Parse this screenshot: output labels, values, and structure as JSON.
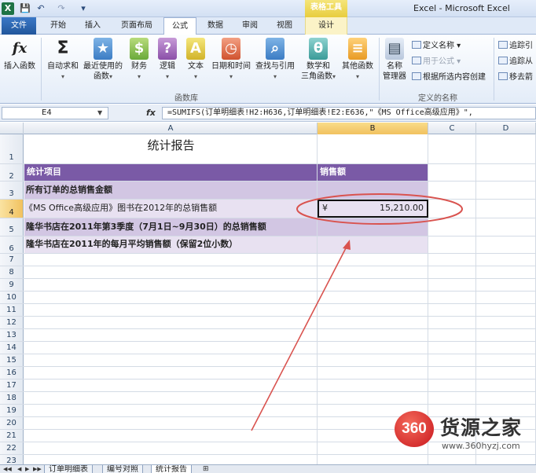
{
  "quick_access": {
    "excel": "X",
    "save": "💾",
    "undo": "↶",
    "redo": "↷",
    "customize": "▾"
  },
  "app_title": "Excel - Microsoft Excel",
  "context_tab_group": "表格工具",
  "tabs": [
    "文件",
    "开始",
    "插入",
    "页面布局",
    "公式",
    "数据",
    "审阅",
    "视图",
    "设计"
  ],
  "ribbon": {
    "insert_function": "插入函数",
    "autosum": [
      "自动求和",
      ""
    ],
    "recent": [
      "最近使用的",
      "函数"
    ],
    "financial": [
      "财务",
      ""
    ],
    "logical": [
      "逻辑",
      ""
    ],
    "text": [
      "文本",
      ""
    ],
    "datetime": [
      "日期和时间",
      ""
    ],
    "lookup": [
      "查找与引用",
      ""
    ],
    "math": [
      "数学和",
      "三角函数"
    ],
    "more": [
      "其他函数",
      ""
    ],
    "name_manager": [
      "名称",
      "管理器"
    ],
    "define_name": "定义名称",
    "use_in_formula": "用于公式",
    "create_from_selection": "根据所选内容创建",
    "trace_precedents": "追踪引",
    "trace_dependents": "追踪从",
    "remove_arrows": "移去箭",
    "group_function_library": "函数库",
    "group_defined_names": "定义的名称"
  },
  "formula_bar": {
    "name_box": "E4",
    "fx": "fx",
    "formula": "=SUMIFS(订单明细表!H2:H636,订单明细表!E2:E636,\"《MS Office高级应用》\","
  },
  "columns": [
    "A",
    "B",
    "C",
    "D"
  ],
  "rows": [
    "1",
    "2",
    "3",
    "4",
    "5",
    "6",
    "7",
    "8",
    "9",
    "10",
    "11",
    "12",
    "13",
    "14",
    "15",
    "16",
    "17",
    "18",
    "19",
    "20",
    "21",
    "22",
    "23"
  ],
  "sheet": {
    "title": "统计报告",
    "header_item": "统计项目",
    "header_sales": "销售额",
    "item1": "所有订单的总销售金额",
    "item2": "《MS Office高级应用》图书在2012年的总销售额",
    "item3": "隆华书店在2011年第3季度（7月1日~9月30日）的总销售额",
    "item4": "隆华书店在2011年的每月平均销售额（保留2位小数）",
    "currency": "¥",
    "item2_value": "15,210.00"
  },
  "sheet_tabs": [
    "订单明细表",
    "编号对照",
    "统计报告"
  ],
  "watermark": {
    "logo": "360",
    "text": "货源之家",
    "url": "www.360hyzj.com"
  },
  "colors": {
    "header_purple": "#7a5aa6",
    "band_dark": "#d2c6e3",
    "band_light": "#e8e1f1",
    "annotation_red": "#d9534f"
  }
}
